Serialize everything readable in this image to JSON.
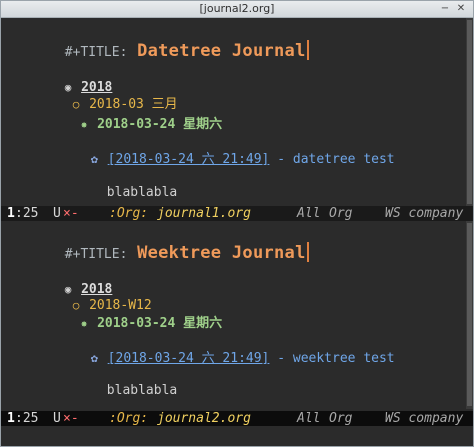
{
  "window": {
    "title": "[journal2.org]"
  },
  "panes": [
    {
      "title_keyword": "#+TITLE:",
      "title": "Datetree Journal",
      "year": "2018",
      "month": "2018-03 三月",
      "day": "2018-03-24 星期六",
      "entry_link": "[2018-03-24 六 21:49]",
      "entry_separator": " - ",
      "entry_text": "datetree test",
      "body": "blablabla",
      "modeline": {
        "line": "1",
        "col": ":25",
        "encoding": "U",
        "modified": "×-",
        "mode": ":Org:",
        "buffer": "journal1.org",
        "position": "All",
        "major": "Org",
        "workspace": "WS company"
      }
    },
    {
      "title_keyword": "#+TITLE:",
      "title": "Weektree Journal",
      "year": "2018",
      "month": "2018-W12",
      "day": "2018-03-24 星期六",
      "entry_link": "[2018-03-24 六 21:49]",
      "entry_separator": " - ",
      "entry_text": "weektree test",
      "body": "blablabla",
      "modeline": {
        "line": "1",
        "col": ":25",
        "encoding": "U",
        "modified": "×-",
        "mode": ":Org:",
        "buffer": "journal2.org",
        "position": "All",
        "major": "Org",
        "workspace": "WS company"
      }
    }
  ],
  "colors": {
    "background": "#2b2b2b",
    "title": "#ef9a5a",
    "level2": "#e8b84a",
    "level3": "#9fd08a",
    "link": "#6fa6e8"
  }
}
